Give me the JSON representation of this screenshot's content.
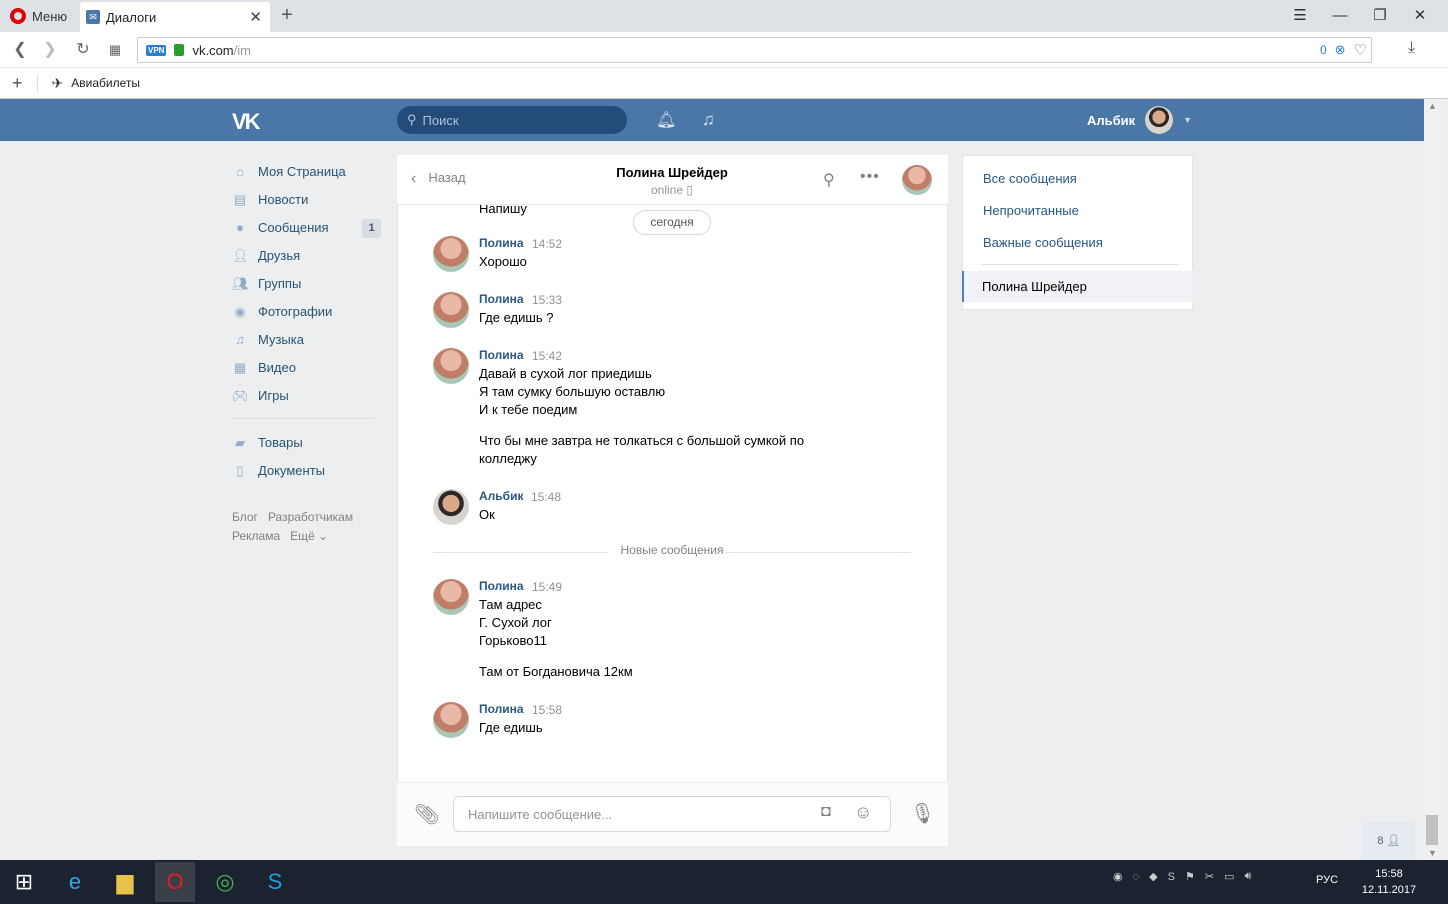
{
  "browser": {
    "menu_label": "Меню",
    "tab_title": "Диалоги",
    "url_host": "vk.com",
    "url_path": "/im",
    "vpn_label": "VPN",
    "adblock_count": "0",
    "bookmark": "Авиабилеты"
  },
  "vk": {
    "logo": "VK",
    "search_placeholder": "Поиск",
    "user_name": "Альбик"
  },
  "left_menu": {
    "items": [
      {
        "label": "Моя Страница",
        "icon": "home-icon"
      },
      {
        "label": "Новости",
        "icon": "news-icon"
      },
      {
        "label": "Сообщения",
        "icon": "messages-icon",
        "badge": "1"
      },
      {
        "label": "Друзья",
        "icon": "friends-icon"
      },
      {
        "label": "Группы",
        "icon": "groups-icon"
      },
      {
        "label": "Фотографии",
        "icon": "camera-icon"
      },
      {
        "label": "Музыка",
        "icon": "music-icon"
      },
      {
        "label": "Видео",
        "icon": "video-icon"
      },
      {
        "label": "Игры",
        "icon": "games-icon"
      }
    ],
    "extra": [
      {
        "label": "Товары",
        "icon": "bag-icon"
      },
      {
        "label": "Документы",
        "icon": "document-icon"
      }
    ],
    "footer": [
      "Блог",
      "Разработчикам",
      "Реклама",
      "Ещё ⌄"
    ]
  },
  "chat": {
    "back_label": "Назад",
    "name": "Полина Шрейдер",
    "status": "online",
    "cut_text": "Напишу",
    "date_divider": "сегодня",
    "new_divider": "Новые сообщения",
    "input_placeholder": "Напишите сообщение...",
    "messages": [
      {
        "author": "Полина",
        "time": "14:52",
        "lines": [
          "Хорошо"
        ]
      },
      {
        "author": "Полина",
        "time": "15:33",
        "lines": [
          "Где едишь ?"
        ]
      },
      {
        "author": "Полина",
        "time": "15:42",
        "lines": [
          "Давай в сухой лог приедишь",
          "Я там сумку большую оставлю",
          "И к тебе поедим"
        ],
        "lines2": [
          "Что бы мне завтра не толкаться с большой сумкой по",
          "колледжу"
        ]
      },
      {
        "author": "Альбик",
        "time": "15:48",
        "lines": [
          "Ок"
        ]
      },
      {
        "author": "Полина",
        "time": "15:49",
        "lines": [
          "Там адрес",
          "Г. Сухой лог",
          "Горьково11"
        ],
        "lines2": [
          "Там от Богдановича 12км"
        ]
      },
      {
        "author": "Полина",
        "time": "15:58",
        "lines": [
          "Где едишь"
        ]
      }
    ]
  },
  "right_menu": {
    "all": "Все сообщения",
    "unread": "Непрочитанные",
    "important": "Важные сообщения",
    "active": "Полина Шрейдер"
  },
  "friends_online": "8",
  "taskbar": {
    "lang": "РУС",
    "time": "15:58",
    "date": "12.11.2017"
  },
  "colors": {
    "accent": "#4a76a8",
    "link": "#2a5885"
  }
}
